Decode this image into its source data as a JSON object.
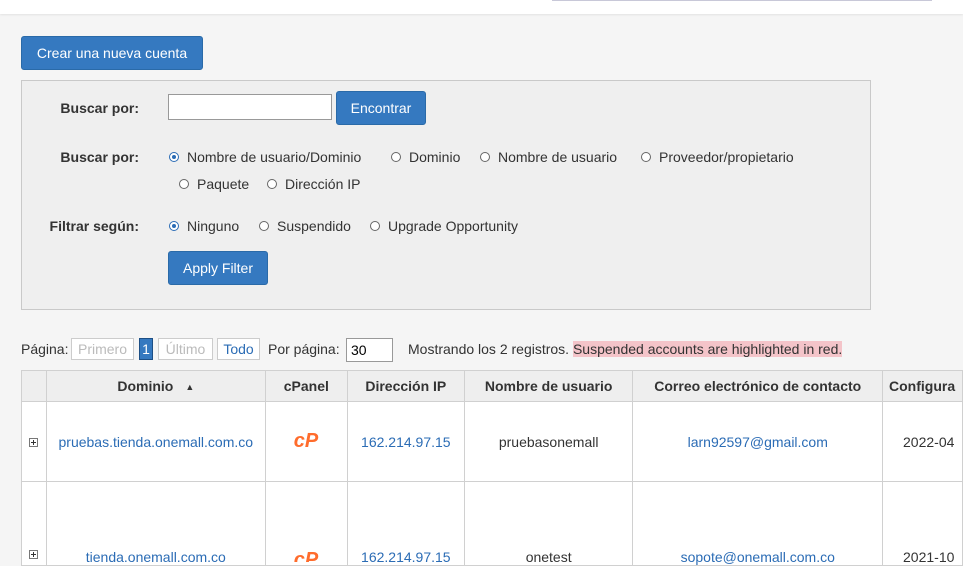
{
  "create_account_label": "Crear una nueva cuenta",
  "search": {
    "label": "Buscar por:",
    "input_value": "",
    "find_label": "Encontrar"
  },
  "search_by": {
    "label": "Buscar por:",
    "options": [
      "Nombre de usuario/Dominio",
      "Dominio",
      "Nombre de usuario",
      "Proveedor/propietario",
      "Paquete",
      "Dirección IP"
    ],
    "selected": "Nombre de usuario/Dominio"
  },
  "filter": {
    "label": "Filtrar según:",
    "options": [
      "Ninguno",
      "Suspendido",
      "Upgrade Opportunity"
    ],
    "selected": "Ninguno",
    "apply_label": "Apply Filter"
  },
  "pager": {
    "page_label": "Página:",
    "first": "Primero",
    "current": "1",
    "last": "Último",
    "all": "Todo",
    "per_page_label": "Por página:",
    "per_page_value": "30",
    "showing": "Mostrando los 2 registros.",
    "suspended_note": "Suspended accounts are highlighted in red."
  },
  "table": {
    "columns": [
      "Dominio",
      "cPanel",
      "Dirección IP",
      "Nombre de usuario",
      "Correo electrónico de contacto",
      "Configura"
    ],
    "rows": [
      {
        "domain": "pruebas.tienda.onemall.com.co",
        "ip": "162.214.97.15",
        "user": "pruebasonemall",
        "email": "larn92597@gmail.com",
        "setup": "2022-04"
      },
      {
        "domain": "tienda.onemall.com.co",
        "ip": "162.214.97.15",
        "user": "onetest",
        "email": "sopote@onemall.com.co",
        "setup": "2021-10"
      }
    ]
  },
  "colors": {
    "button": "#3579c0",
    "link": "#2b6cb5",
    "cpanel_logo": "#ff6c2c",
    "suspended_highlight": "#f4c4c9"
  },
  "icons": {
    "cpanel": "cpanel-logo-icon",
    "expand": "expand-plus-icon",
    "sort": "sort-ascending-icon"
  }
}
